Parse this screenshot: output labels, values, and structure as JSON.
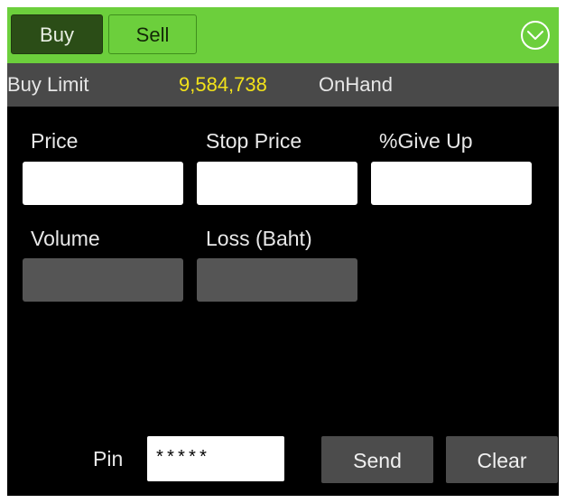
{
  "tabs": {
    "buy_label": "Buy",
    "sell_label": "Sell",
    "active": "Buy"
  },
  "header_icon": "chevron-down-circle-icon",
  "info": {
    "buy_limit_label": "Buy Limit",
    "buy_limit_value": "9,584,738",
    "onhand_label": "OnHand"
  },
  "fields": {
    "price_label": "Price",
    "price_value": "",
    "stop_price_label": "Stop Price",
    "stop_price_value": "",
    "give_up_label": "%Give Up",
    "give_up_value": "",
    "volume_label": "Volume",
    "volume_value": "",
    "loss_label": "Loss (Baht)",
    "loss_value": ""
  },
  "pin": {
    "label": "Pin",
    "value": "*****"
  },
  "actions": {
    "send_label": "Send",
    "clear_label": "Clear"
  },
  "colors": {
    "header_green": "#6ccf3c",
    "active_tab": "#2b4d17",
    "info_bar": "#494949",
    "limit_value": "#f2e21a",
    "background": "#000000"
  }
}
